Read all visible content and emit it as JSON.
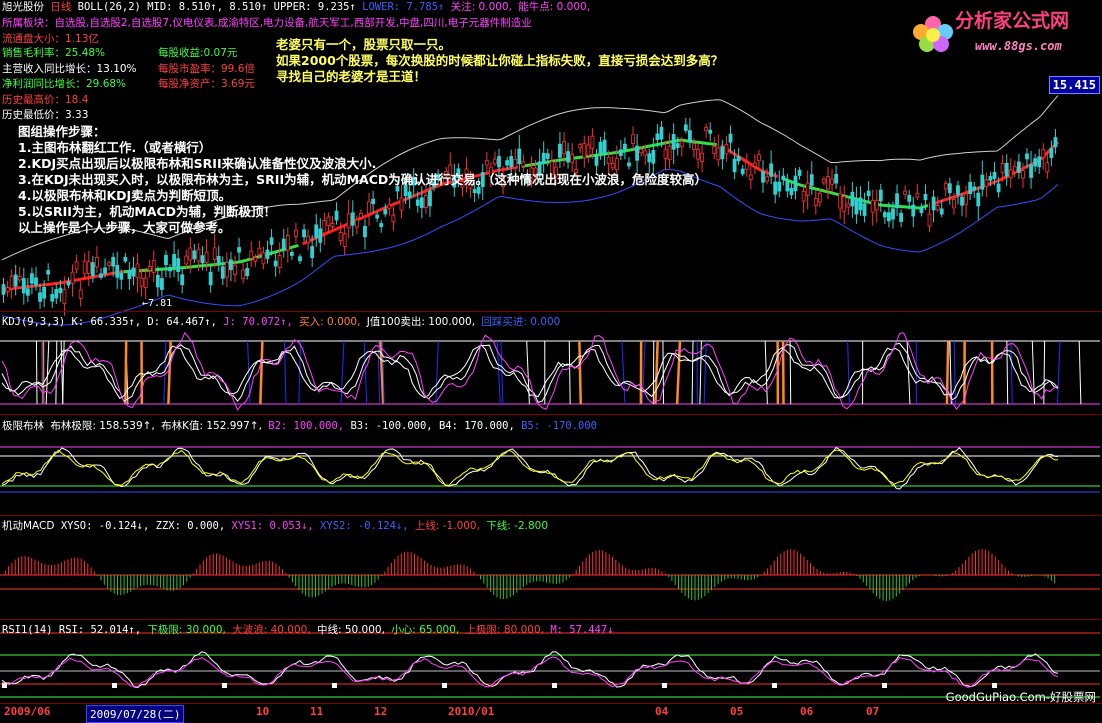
{
  "header": {
    "stock_name": "旭光股份",
    "period": "日线",
    "boll_label": "BOLL(26,2)",
    "mid": "MID: 8.510↑, 8.510↑",
    "upper": "UPPER: 9.235↑",
    "lower": "LOWER: 7.785↑",
    "guanzhu": "关注: 0.000,",
    "niuniu": "能牛点: 0.000,"
  },
  "sector_line": "所属板块：自选股,自选股2,自选股7,仪电仪表,成渝特区,电力设备,航天军工,西部开发,中盘,四川,电子元器件制造业",
  "fundamentals": {
    "float_cap": "流通盘大小：1.13亿",
    "gross_margin": "销售毛利率：25.48%",
    "eps": "每股收益:0.07元",
    "revenue_growth": "主营收入同比增长：13.10%",
    "pe": "每股市盈率：99.6倍",
    "profit_growth": "净利润同比增长：29.68%",
    "nav": "每股净资产：3.69元",
    "hist_high": "历史最高价：18.4",
    "hist_low": "历史最低价：3.33"
  },
  "quote_text": [
    "老婆只有一个，股票只取一只。",
    "如果2000个股票，每次换股的时候都让你碰上指标失败，直接亏损会达到多高？",
    "寻找自己的老婆才是王道！"
  ],
  "steps_text": [
    "图组操作步骤：",
    "1.主图布林翻红工作.（或者横行）",
    "2.KDJ买点出现后以极限布林和SRII来确认准备性仪及波浪大小.",
    "3.在KDJ未出现买入时，以极限布林为主，SRII为辅，机动MACD为确认进行交易。（这种情况出现在小波浪，危险度较高）",
    "4.以极限布林和KDJ卖点为判断短顶。",
    "5.以SRII为主，机动MACD为辅，判断极顶！",
    "以上操作是个人步骤，大家可做参考。"
  ],
  "low_marker": "7.81",
  "last_price": "15.415",
  "kdj": {
    "name": "KDJ(9,3,3)",
    "k": "K: 66.335↑,",
    "d": "D: 64.467↑,",
    "j": "J: 70.072↑,",
    "buy": "买入: 0.000,",
    "j100sell": "J值100卖出: 100.000,",
    "back": "回踩买进: 0.000"
  },
  "jxbl": {
    "name": "极限布林",
    "limit": "布林极限: 158.539↑,",
    "kval": "布林K值: 152.997↑,",
    "b2": "B2: 100.000,",
    "b3": "B3: -100.000,",
    "b4": "B4: 170.000,",
    "b5": "B5: -170.000"
  },
  "macd": {
    "name": "机动MACD",
    "xyso": "XYSO: -0.124↓,",
    "zzx": "ZZX: 0.000,",
    "xys1": "XYS1: 0.053↓,",
    "xys2": "XYS2: -0.124↓,",
    "upper": "上线: -1.000,",
    "lower": "下线: -2.800"
  },
  "rsi": {
    "name": "RSI1(14)",
    "rsi": "RSI: 52.014↑,",
    "low_limit": "下极限: 30.000,",
    "big_wave": "大波浪: 40.000,",
    "mid": "中线: 50.000,",
    "careful": "小心: 65.000,",
    "high_limit": "上极限: 80.000,",
    "m": "M: 57.447↓"
  },
  "time_axis": {
    "labels": [
      "2009/06",
      "10",
      "11",
      "12",
      "2010/01",
      "04",
      "05",
      "06",
      "07"
    ],
    "current": "2009/07/28(二)"
  },
  "logo": {
    "title": "分析家公式网",
    "url": "www.88gs.com"
  },
  "watermark": "GoodGuPiao.Com-好股票网",
  "colors": {
    "bg": "#000000",
    "up": "#ff3030",
    "down": "#30c0c0",
    "axis": "#800000"
  }
}
